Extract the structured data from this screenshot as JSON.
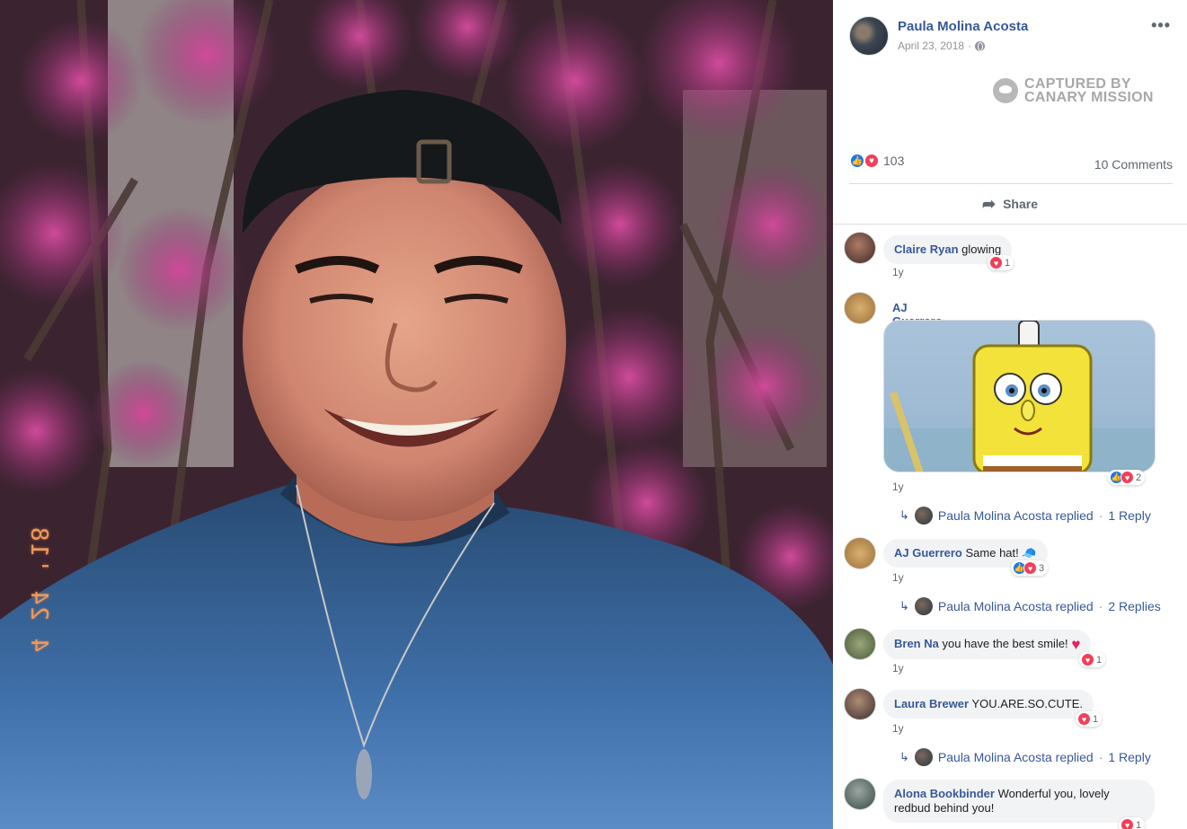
{
  "post": {
    "author": "Paula Molina Acosta",
    "date": "April 23, 2018",
    "date_separator": "·",
    "more_label": "•••",
    "watermark_line1": "CAPTURED BY",
    "watermark_line2": "CANARY MISSION",
    "reaction_count": "103",
    "comments_count": "10 Comments",
    "share_label": "Share",
    "photo_date_stamp": "4 24 '18"
  },
  "comments": [
    {
      "name": "Claire Ryan",
      "text": "glowing",
      "time": "1y",
      "reactions": "1"
    },
    {
      "name": "AJ Guerrero",
      "text": "",
      "time": "1y",
      "reactions": "2",
      "reply_author": "Paula Molina Acosta replied",
      "reply_count": "1 Reply"
    },
    {
      "name": "AJ Guerrero",
      "text": "Same hat!",
      "time": "1y",
      "reactions": "3",
      "reply_author": "Paula Molina Acosta replied",
      "reply_count": "2 Replies"
    },
    {
      "name": "Bren Na",
      "text": "you have the best smile!",
      "time": "1y",
      "reactions": "1"
    },
    {
      "name": "Laura Brewer",
      "text": "YOU.ARE.SO.CUTE.",
      "time": "1y",
      "reactions": "1",
      "reply_author": "Paula Molina Acosta replied",
      "reply_count": "1 Reply"
    },
    {
      "name": "Alona Bookbinder",
      "text": "Wonderful you, lovely",
      "text2": "redbud behind you!",
      "reactions": "1"
    }
  ],
  "reply_separator": "·",
  "colors": {
    "link": "#385898",
    "like": "#1877f2",
    "love": "#f33e58",
    "bubble": "#f2f3f5"
  }
}
